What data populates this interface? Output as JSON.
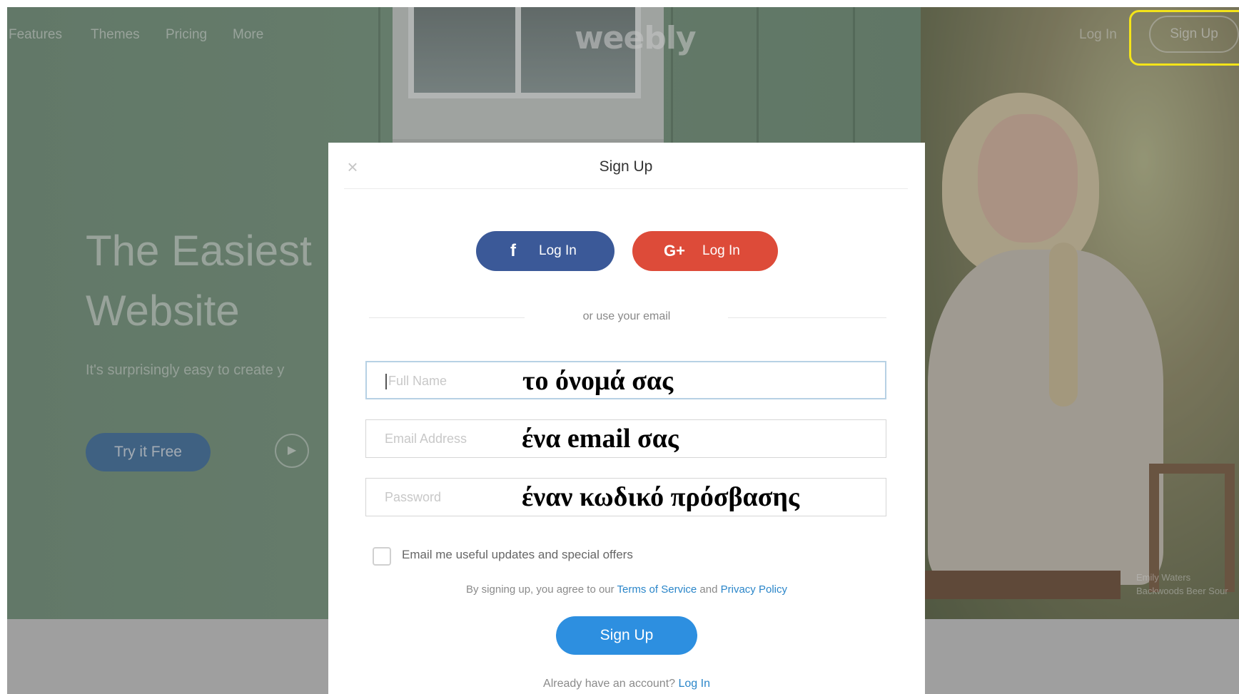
{
  "nav": {
    "links": [
      "Features",
      "Themes",
      "Pricing",
      "More"
    ],
    "logo": "weebly",
    "login": "Log In",
    "signup": "Sign Up"
  },
  "hero": {
    "title_line1": "The Easiest",
    "title_line2": "Website",
    "subtitle": "It's surprisingly easy to create y",
    "try_button": "Try it Free",
    "play_icon": "play-icon",
    "caption_line1": "Emily Waters",
    "caption_line2": "Backwoods Beer Sour"
  },
  "modal": {
    "title": "Sign Up",
    "close_icon": "close-icon",
    "facebook_login": "Log In",
    "google_login": "Log In",
    "facebook_icon": "f",
    "google_icon": "G+",
    "divider_text": "or use your email",
    "fields": {
      "full_name_placeholder": "Full Name",
      "email_placeholder": "Email Address",
      "password_placeholder": "Password"
    },
    "annotations": {
      "full_name": "το όνομά σας",
      "email": "ένα email σας",
      "password": "έναν κωδικό πρόσβασης"
    },
    "checkbox_label": "Email me useful updates and special offers",
    "checkbox_checked": false,
    "terms_prefix": "By signing up, you agree to our",
    "terms_link": "Terms of Service",
    "terms_and": "and",
    "privacy_link": "Privacy Policy",
    "signup_button": "Sign Up",
    "already_text": "Already have an account?",
    "already_link": "Log In"
  },
  "colors": {
    "facebook": "#3b5998",
    "google": "#dd4b39",
    "primary": "#2d8fe0",
    "link": "#2b86c9",
    "highlight": "#f4e419"
  }
}
